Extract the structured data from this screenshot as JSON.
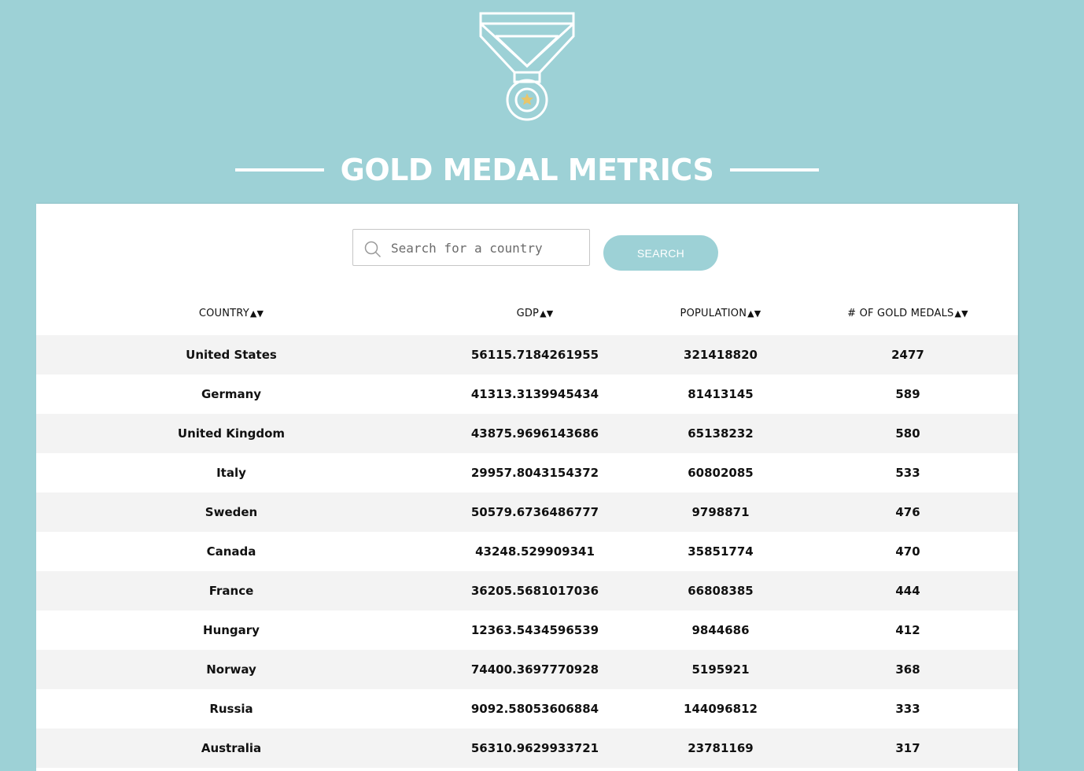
{
  "page": {
    "title": "GOLD MEDAL METRICS",
    "background_color": "#9dd1d6",
    "logo_icon": "gold-medal-icon"
  },
  "search": {
    "placeholder": "Search for a country",
    "value": "",
    "button_label": "SEARCH",
    "icon": "search-icon"
  },
  "table": {
    "sort_indicator": "▲▼",
    "columns": [
      {
        "key": "country",
        "label": "COUNTRY"
      },
      {
        "key": "gdp",
        "label": "GDP"
      },
      {
        "key": "population",
        "label": "POPULATION"
      },
      {
        "key": "gold_medals",
        "label": "# OF GOLD MEDALS"
      }
    ],
    "rows": [
      {
        "country": "United States",
        "gdp": "56115.7184261955",
        "population": "321418820",
        "gold_medals": "2477"
      },
      {
        "country": "Germany",
        "gdp": "41313.3139945434",
        "population": "81413145",
        "gold_medals": "589"
      },
      {
        "country": "United Kingdom",
        "gdp": "43875.9696143686",
        "population": "65138232",
        "gold_medals": "580"
      },
      {
        "country": "Italy",
        "gdp": "29957.8043154372",
        "population": "60802085",
        "gold_medals": "533"
      },
      {
        "country": "Sweden",
        "gdp": "50579.6736486777",
        "population": "9798871",
        "gold_medals": "476"
      },
      {
        "country": "Canada",
        "gdp": "43248.529909341",
        "population": "35851774",
        "gold_medals": "470"
      },
      {
        "country": "France",
        "gdp": "36205.5681017036",
        "population": "66808385",
        "gold_medals": "444"
      },
      {
        "country": "Hungary",
        "gdp": "12363.5434596539",
        "population": "9844686",
        "gold_medals": "412"
      },
      {
        "country": "Norway",
        "gdp": "74400.3697770928",
        "population": "5195921",
        "gold_medals": "368"
      },
      {
        "country": "Russia",
        "gdp": "9092.58053606884",
        "population": "144096812",
        "gold_medals": "333"
      },
      {
        "country": "Australia",
        "gdp": "56310.9629933721",
        "population": "23781169",
        "gold_medals": "317"
      }
    ]
  }
}
